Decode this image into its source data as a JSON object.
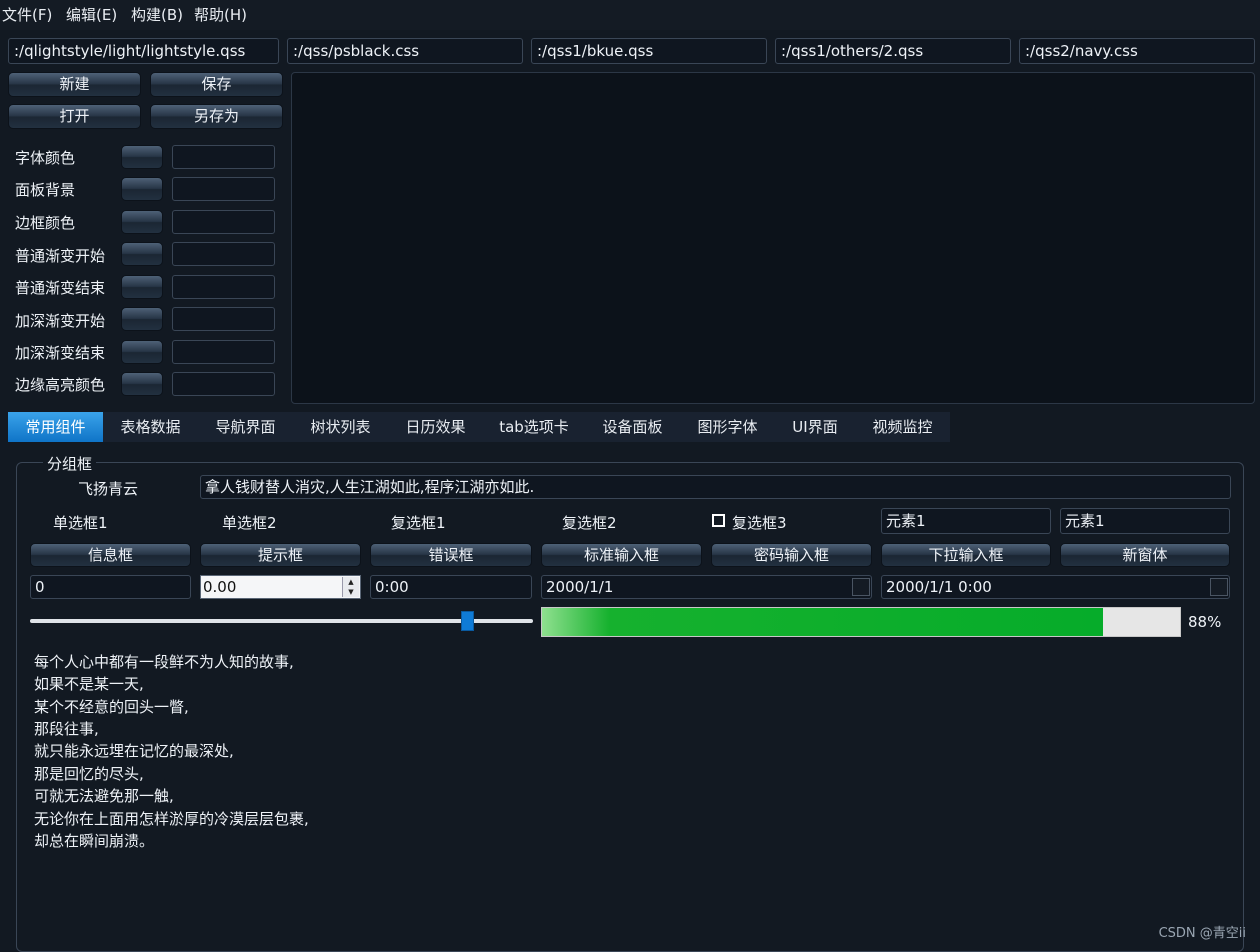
{
  "menu": [
    "文件(F)",
    "编辑(E)",
    "构建(B)",
    "帮助(H)"
  ],
  "paths": [
    ":/qlightstyle/light/lightstyle.qss",
    ":/qss/psblack.css",
    ":/qss1/bkue.qss",
    ":/qss1/others/2.qss",
    ":/qss2/navy.css"
  ],
  "file_buttons": {
    "new": "新建",
    "save": "保存",
    "open": "打开",
    "save_as": "另存为"
  },
  "color_labels": [
    "字体颜色",
    "面板背景",
    "边框颜色",
    "普通渐变开始",
    "普通渐变结束",
    "加深渐变开始",
    "加深渐变结束",
    "边缘高亮颜色"
  ],
  "tabs": [
    "常用组件",
    "表格数据",
    "导航界面",
    "树状列表",
    "日历效果",
    "tab选项卡",
    "设备面板",
    "图形字体",
    "UI界面",
    "视频监控"
  ],
  "group": {
    "title": "分组框",
    "name_label": "飞扬青云",
    "motto": "拿人钱财替人消灾,人生江湖如此,程序江湖亦如此.",
    "radio1": "单选框1",
    "radio2": "单选框2",
    "check1": "复选框1",
    "check2": "复选框2",
    "check3": "复选框3",
    "combo1": "元素1",
    "combo2": "元素1",
    "buttons": [
      "信息框",
      "提示框",
      "错误框",
      "标准输入框",
      "密码输入框",
      "下拉输入框",
      "新窗体"
    ],
    "spin_int": "0",
    "spin_double": "0.00",
    "time": "0:00",
    "date": "2000/1/1",
    "datetime": "2000/1/1 0:00",
    "slider_fraction": 0.87,
    "progress_percent": 88,
    "progress_text": "88%"
  },
  "poem": [
    "每个人心中都有一段鲜不为人知的故事,",
    "如果不是某一天,",
    "某个不经意的回头一瞥,",
    "那段往事,",
    "就只能永远埋在记忆的最深处,",
    "那是回忆的尽头,",
    "可就无法避免那一触,",
    "无论你在上面用怎样淤厚的冷漠层层包裹,",
    "却总在瞬间崩溃。"
  ],
  "watermark": "CSDN @青空ii"
}
